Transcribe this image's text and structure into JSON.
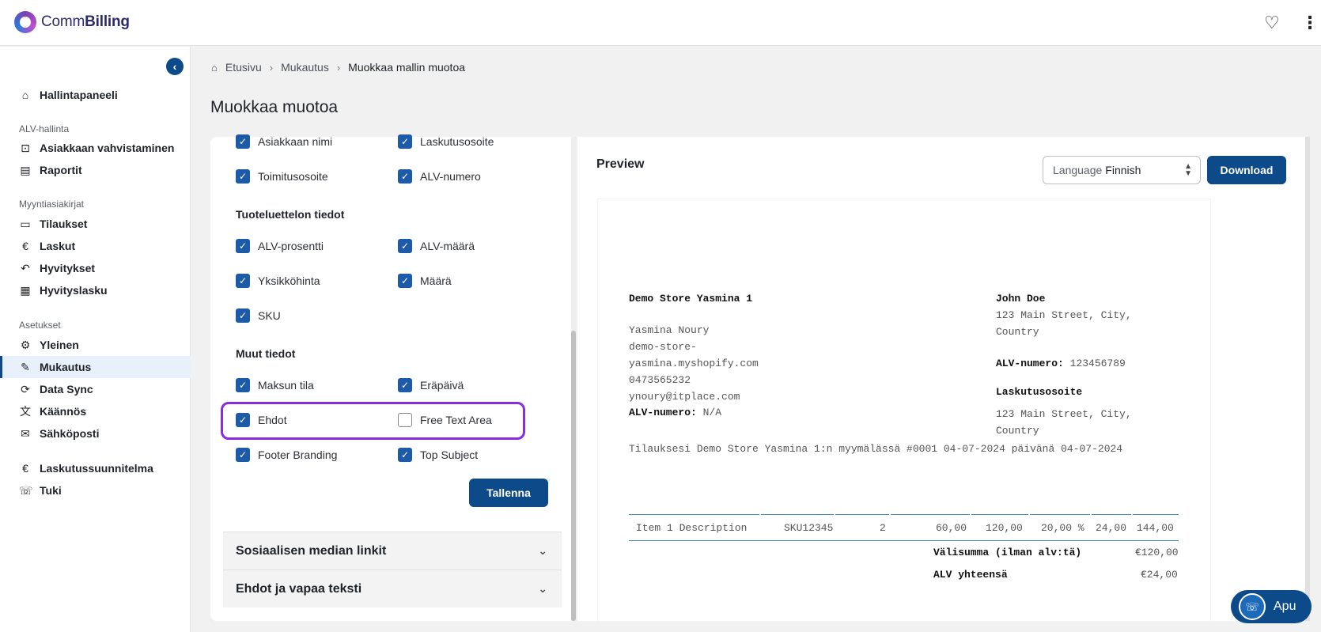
{
  "app": {
    "brand_light": "Comm",
    "brand_bold": "Billing"
  },
  "topbar": {
    "favorite_icon": "heart-icon",
    "menu_icon": "more-vertical-icon"
  },
  "sidebar": {
    "dashboard": "Hallintapaneeli",
    "sections": {
      "vat": "ALV-hallinta",
      "sales": "Myyntiasiakirjat",
      "settings": "Asetukset"
    },
    "items": {
      "customer_verification": "Asiakkaan vahvistaminen",
      "reports": "Raportit",
      "orders": "Tilaukset",
      "invoices": "Laskut",
      "refunds": "Hyvitykset",
      "credit_notes": "Hyvityslasku",
      "general": "Yleinen",
      "customization": "Mukautus",
      "data_sync": "Data Sync",
      "translations": "Käännös",
      "email": "Sähköposti",
      "billing_plan": "Laskutussuunnitelma",
      "support": "Tuki"
    }
  },
  "breadcrumb": {
    "home": "Etusivu",
    "parent": "Mukautus",
    "current": "Muokkaa mallin muotoa"
  },
  "page_title": "Muokkaa muotoa",
  "settings": {
    "customer": {
      "customer_name": "Asiakkaan nimi",
      "billing_address": "Laskutusosoite",
      "shipping_address": "Toimitusosoite",
      "vat_number": "ALV-numero"
    },
    "product_list_title": "Tuoteluettelon tiedot",
    "product_list": {
      "vat_percent": "ALV-prosentti",
      "vat_amount": "ALV-määrä",
      "unit_price": "Yksikköhinta",
      "quantity": "Määrä",
      "sku": "SKU"
    },
    "other_title": "Muut tiedot",
    "other": {
      "payment_status": "Maksun tila",
      "due_date": "Eräpäivä",
      "terms": "Ehdot",
      "free_text_area": "Free Text Area",
      "footer_branding": "Footer Branding",
      "top_subject": "Top Subject"
    },
    "save_label": "Tallenna",
    "accordion_social": "Sosiaalisen median linkit",
    "accordion_terms": "Ehdot ja vapaa teksti"
  },
  "preview": {
    "title": "Preview",
    "language_label": "Language",
    "language_value": "Finnish",
    "download_label": "Download",
    "store_name": "Demo Store Yasmina 1",
    "store_lines": [
      "Yasmina Noury",
      "demo-store-",
      "yasmina.myshopify.com",
      "0473565232",
      "ynoury@itplace.com"
    ],
    "store_vat_label": "ALV-numero:",
    "store_vat_value": "N/A",
    "customer_name": "John Doe",
    "customer_address_1": "123 Main Street, City,",
    "customer_address_2": "Country",
    "customer_vat_label": "ALV-numero:",
    "customer_vat_value": "123456789",
    "billing_title": "Laskutusosoite",
    "billing_address_1": "123 Main Street, City,",
    "billing_address_2": "Country",
    "order_line": "Tilauksesi Demo Store Yasmina 1:n myymälässä #0001 04-07-2024 päivänä 04-07-2024",
    "item": {
      "description": "Item 1 Description",
      "sku": "SKU12345",
      "qty": "2",
      "unit_price": "60,00",
      "total": "120,00",
      "vat_percent": "20,00 %",
      "vat_amount": "24,00",
      "gross": "144,00"
    },
    "subtotal_label": "Välisumma (ilman alv:tä)",
    "subtotal_value": "€120,00",
    "vat_total_label": "ALV yhteensä",
    "vat_total_value": "€24,00"
  },
  "help": {
    "label": "Apu"
  },
  "colors": {
    "primary": "#0d4a8a",
    "highlight": "#8a2be2",
    "checkbox": "#1d5aa8"
  }
}
